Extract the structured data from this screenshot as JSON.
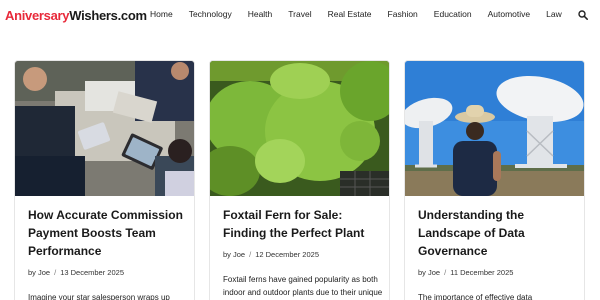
{
  "site": {
    "logo_part1": "Aniversary",
    "logo_part2": "Wishers",
    "logo_part3": ".com",
    "accent_color": "#e8293a"
  },
  "nav": {
    "items": [
      "Home",
      "Technology",
      "Health",
      "Travel",
      "Real Estate",
      "Fashion",
      "Education",
      "Automotive",
      "Law"
    ],
    "search_icon": "search-icon"
  },
  "cards": [
    {
      "title": "How Accurate Commission Payment Boosts Team Performance",
      "author_prefix": "by",
      "author": "Joe",
      "separator": "/",
      "date": "13 December 2025",
      "excerpt": "Imagine your star salesperson wraps up"
    },
    {
      "title": "Foxtail Fern for Sale: Finding the Perfect Plant",
      "author_prefix": "by",
      "author": "Joe",
      "separator": "/",
      "date": "12 December 2025",
      "excerpt": "Foxtail ferns have gained popularity as both indoor and outdoor plants due to their unique attractive... With their lush"
    },
    {
      "title": "Understanding the Landscape of Data Governance",
      "author_prefix": "by",
      "author": "Joe",
      "separator": "/",
      "date": "11 December 2025",
      "excerpt": "The importance of effective data"
    }
  ]
}
